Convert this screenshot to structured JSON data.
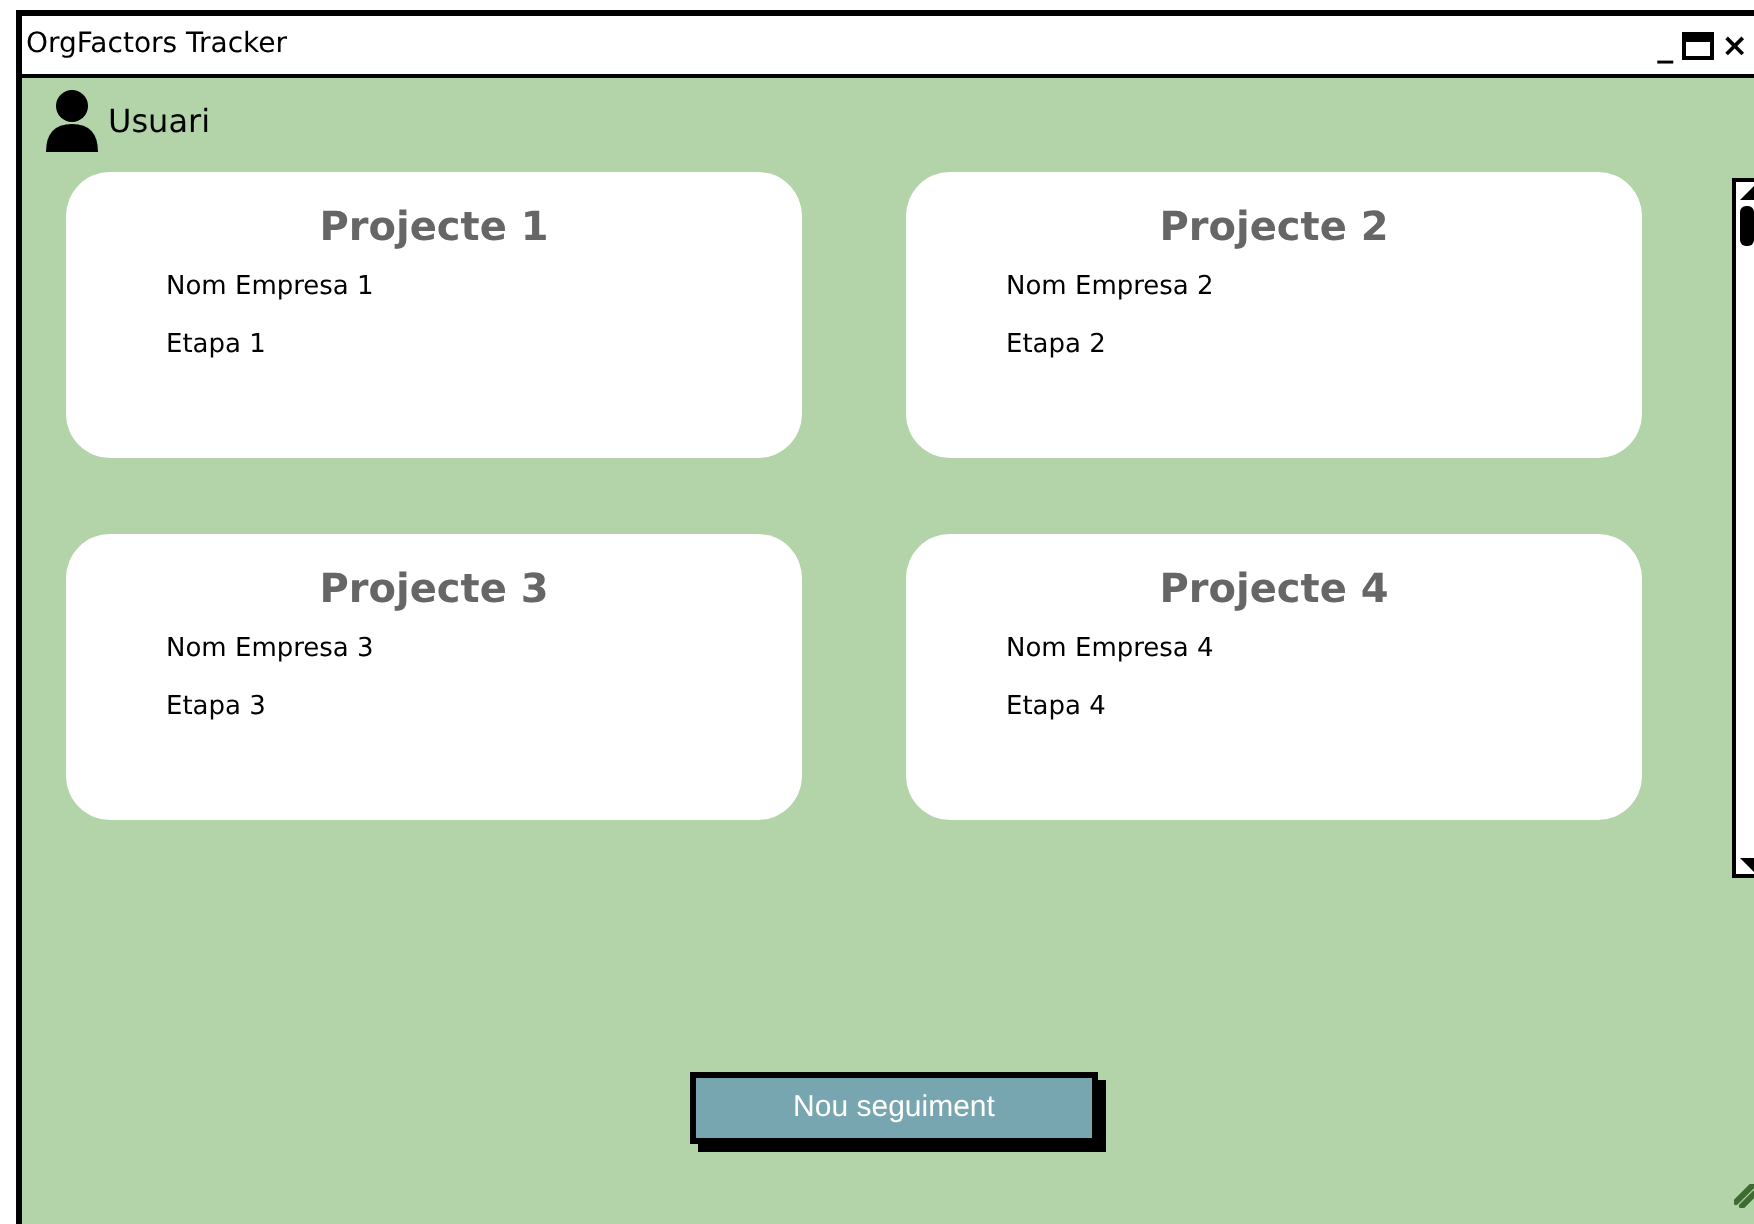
{
  "window": {
    "title": "OrgFactors Tracker",
    "controls": [
      "_",
      "×"
    ]
  },
  "user": {
    "name": "Usuari"
  },
  "projects": [
    {
      "title": "Projecte 1",
      "company": "Nom Empresa 1",
      "stage": "Etapa 1"
    },
    {
      "title": "Projecte 2",
      "company": "Nom Empresa 2",
      "stage": "Etapa 2"
    },
    {
      "title": "Projecte 3",
      "company": "Nom Empresa 3",
      "stage": "Etapa 3"
    },
    {
      "title": "Projecte 4",
      "company": "Nom Empresa 4",
      "stage": "Etapa 4"
    }
  ],
  "button": {
    "label": "Nou seguiment"
  }
}
